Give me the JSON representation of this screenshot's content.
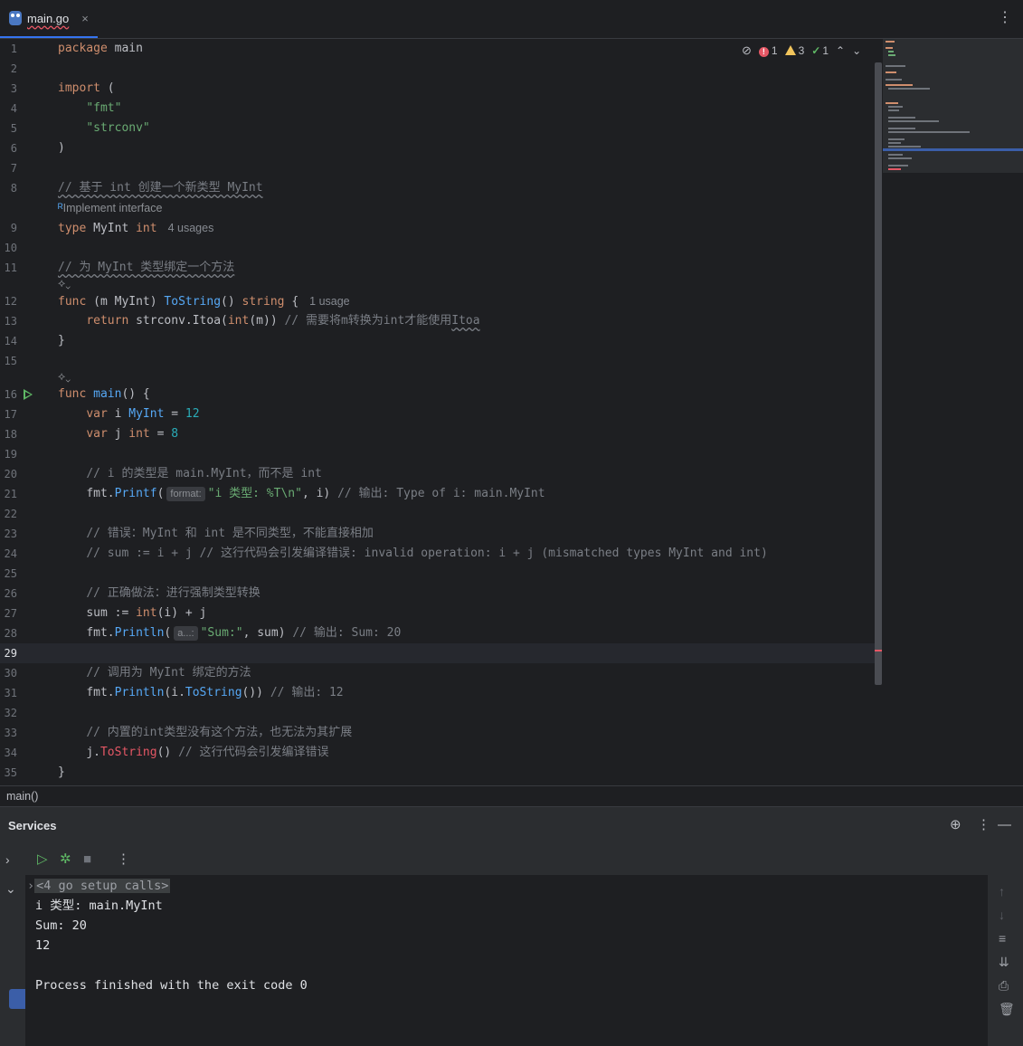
{
  "tab": {
    "file_name": "main.go",
    "close": "×",
    "menu": "⋮"
  },
  "inspection": {
    "errors": "1",
    "warnings": "3",
    "ok": "1"
  },
  "hints": {
    "implement_interface": "Implement interface",
    "usages_4": "4 usages",
    "usage_1": "1 usage",
    "inlay_format": "format:",
    "inlay_a": "a...:"
  },
  "lines": {
    "l1": "package",
    "l1b": " main",
    "l3": "import",
    "l3b": " (",
    "l4": "\"fmt\"",
    "l5": "\"strconv\"",
    "l6": ")",
    "l8": "// 基于 int 创建一个新类型 MyInt",
    "l9a": "type",
    "l9b": " MyInt ",
    "l9c": "int",
    "l11": "// 为 MyInt 类型绑定一个方法",
    "l12a": "func",
    "l12b": " (m ",
    "l12c": "MyInt",
    "l12d": ") ",
    "l12e": "ToString",
    "l12f": "() ",
    "l12g": "string",
    "l12h": " {",
    "l13a": "return",
    "l13b": " strconv.Itoa(",
    "l13c": "int",
    "l13d": "(m)) ",
    "l13e": "// 需要将m转换为int才能使用",
    "l13f": "Itoa",
    "l14": "}",
    "l16a": "func",
    "l16b": " ",
    "l16c": "main",
    "l16d": "() {",
    "l17a": "var",
    "l17b": " i ",
    "l17c": "MyInt",
    "l17d": " = ",
    "l17e": "12",
    "l18a": "var",
    "l18b": " j ",
    "l18c": "int",
    "l18d": " = ",
    "l18e": "8",
    "l20": "// i 的类型是 main.MyInt，而不是 int",
    "l21a": "fmt.",
    "l21b": "Printf",
    "l21c": "(",
    "l21d": "\"i 类型: %T\\n\"",
    "l21e": ", i) ",
    "l21f": "// 输出: Type of i: main.MyInt",
    "l23": "// 错误：MyInt 和 int 是不同类型，不能直接相加",
    "l24": "// sum := i + j // 这行代码会引发编译错误: invalid operation: i + j (mismatched types MyInt and int)",
    "l26": "// 正确做法：进行强制类型转换",
    "l27a": "sum := ",
    "l27b": "int",
    "l27c": "(i) + j",
    "l28a": "fmt.",
    "l28b": "Println",
    "l28c": "(",
    "l28d": "\"Sum:\"",
    "l28e": ", sum) ",
    "l28f": "// 输出: Sum: 20",
    "l30": "// 调用为 MyInt 绑定的方法",
    "l31a": "fmt.",
    "l31b": "Println",
    "l31c": "(i.",
    "l31d": "ToString",
    "l31e": "()) ",
    "l31f": "// 输出: 12",
    "l33": "// 内置的int类型没有这个方法，也无法为其扩展",
    "l34a": "j.",
    "l34b": "ToString",
    "l34c": "() ",
    "l34d": "// 这行代码会引发编译错误",
    "l35": "}"
  },
  "line_numbers": [
    "1",
    "2",
    "3",
    "4",
    "5",
    "6",
    "7",
    "8",
    "9",
    "10",
    "11",
    "12",
    "13",
    "14",
    "15",
    "16",
    "17",
    "18",
    "19",
    "20",
    "21",
    "22",
    "23",
    "24",
    "25",
    "26",
    "27",
    "28",
    "29",
    "30",
    "31",
    "32",
    "33",
    "34",
    "35"
  ],
  "breadcrumb": "main()",
  "services": {
    "title": "Services",
    "console": {
      "setup": "<4 go setup calls>",
      "out1": "i 类型: main.MyInt",
      "out2": "Sum: 20",
      "out3": "12",
      "out4": "Process finished with the exit code 0"
    }
  },
  "colors": {
    "accent": "#3574f0",
    "run_green": "#5fb865",
    "error_red": "#e55765",
    "warning_yellow": "#f2c55c"
  }
}
